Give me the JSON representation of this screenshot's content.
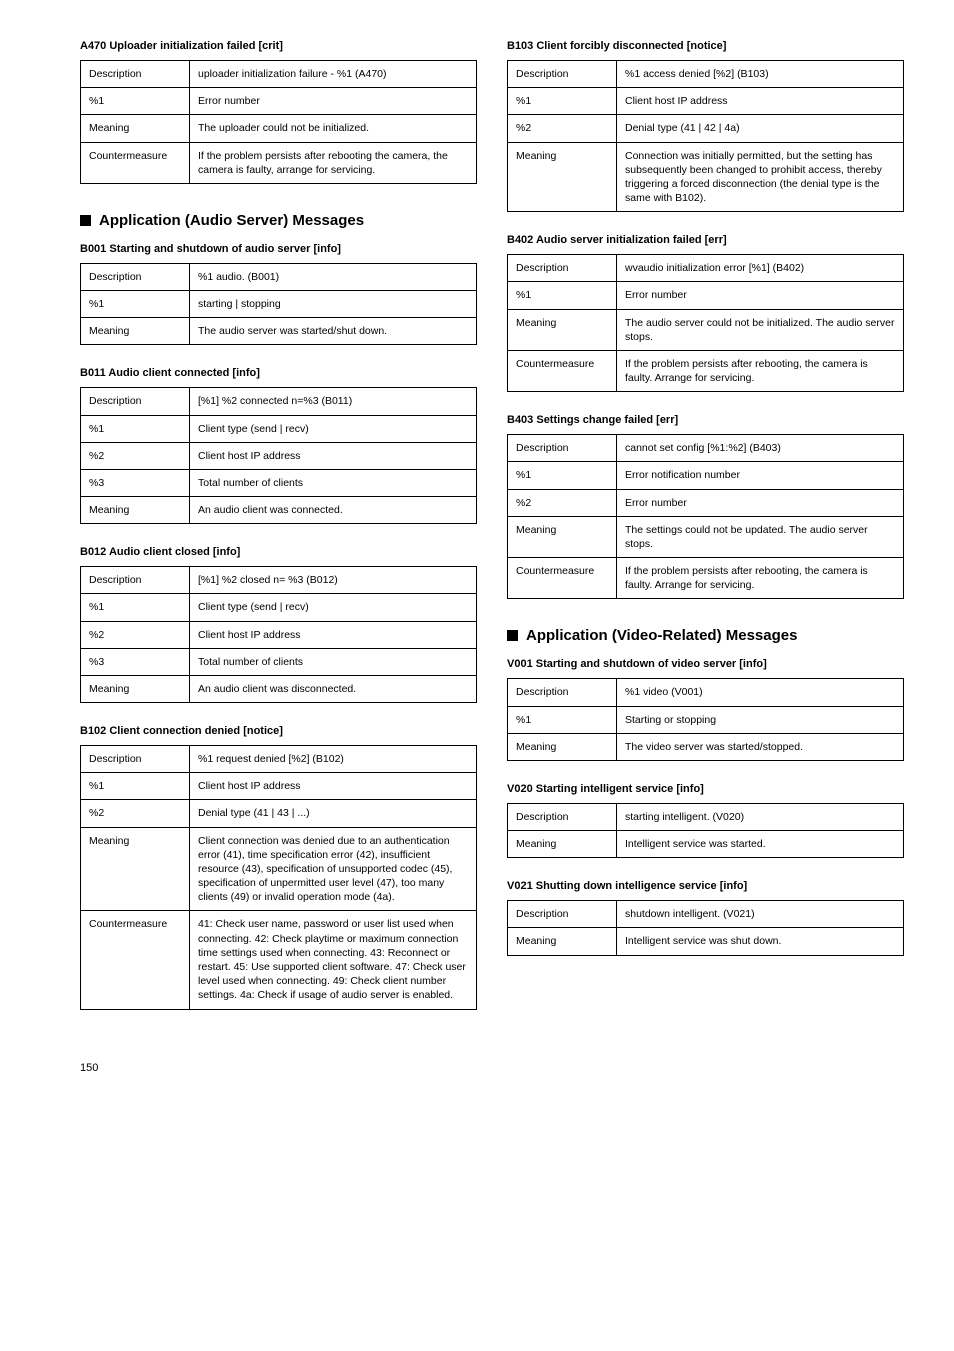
{
  "left": {
    "a470": {
      "title": "A470 Uploader initialization failed [crit]",
      "rows": [
        [
          "Description",
          "uploader initialization failure - %1 (A470)"
        ],
        [
          "%1",
          "Error number"
        ],
        [
          "Meaning",
          "The uploader could not be initialized."
        ],
        [
          "Countermeasure",
          "If the problem persists after rebooting the camera, the camera is faulty, arrange for servicing."
        ]
      ]
    },
    "audioHeading": "Application (Audio Server) Messages",
    "b001": {
      "title": "B001 Starting and shutdown of audio server [info]",
      "rows": [
        [
          "Description",
          "%1 audio. (B001)"
        ],
        [
          "%1",
          "starting | stopping"
        ],
        [
          "Meaning",
          "The audio server was started/shut down."
        ]
      ]
    },
    "b011": {
      "title": "B011 Audio client connected [info]",
      "rows": [
        [
          "Description",
          "[%1] %2 connected n=%3 (B011)"
        ],
        [
          "%1",
          "Client type (send | recv)"
        ],
        [
          "%2",
          "Client host IP address"
        ],
        [
          "%3",
          "Total number of clients"
        ],
        [
          "Meaning",
          "An audio client was connected."
        ]
      ]
    },
    "b012": {
      "title": "B012 Audio client closed [info]",
      "rows": [
        [
          "Description",
          "[%1] %2 closed n= %3 (B012)"
        ],
        [
          "%1",
          "Client type (send | recv)"
        ],
        [
          "%2",
          "Client host IP address"
        ],
        [
          "%3",
          "Total number of clients"
        ],
        [
          "Meaning",
          "An audio client was disconnected."
        ]
      ]
    },
    "b102": {
      "title": "B102 Client connection denied [notice]",
      "rows": [
        [
          "Description",
          "%1 request denied [%2] (B102)"
        ],
        [
          "%1",
          "Client host IP address"
        ],
        [
          "%2",
          "Denial type (41 | 43 | ...)"
        ],
        [
          "Meaning",
          "Client connection was denied due to an authentication error (41), time specification error (42), insufficient resource (43), specification of unsupported codec (45), specification of unpermitted user level (47), too many clients (49) or invalid operation mode (4a)."
        ],
        [
          "Countermeasure",
          "41: Check user name, password or user list used when connecting. 42: Check playtime or maximum connection time settings used when connecting. 43: Reconnect or restart. 45: Use supported client software. 47: Check user level used when connecting. 49: Check client number settings. 4a: Check if usage of audio server is enabled."
        ]
      ]
    }
  },
  "right": {
    "b103": {
      "title": "B103 Client forcibly disconnected [notice]",
      "rows": [
        [
          "Description",
          "%1 access denied [%2] (B103)"
        ],
        [
          "%1",
          "Client host IP address"
        ],
        [
          "%2",
          "Denial type (41 | 42 | 4a)"
        ],
        [
          "Meaning",
          "Connection was initially permitted, but the setting has subsequently been changed to prohibit access, thereby triggering a forced disconnection (the denial type is the same with B102)."
        ]
      ]
    },
    "b402": {
      "title": "B402 Audio server initialization failed [err]",
      "rows": [
        [
          "Description",
          "wvaudio initialization error [%1] (B402)"
        ],
        [
          "%1",
          "Error number"
        ],
        [
          "Meaning",
          "The audio server could not be initialized. The audio server stops."
        ],
        [
          "Countermeasure",
          "If the problem persists after rebooting, the camera is faulty. Arrange for servicing."
        ]
      ]
    },
    "b403": {
      "title": "B403 Settings change failed [err]",
      "rows": [
        [
          "Description",
          "cannot set config [%1:%2] (B403)"
        ],
        [
          "%1",
          "Error notification number"
        ],
        [
          "%2",
          "Error number"
        ],
        [
          "Meaning",
          "The settings could not be updated. The audio server stops."
        ],
        [
          "Countermeasure",
          "If the problem persists after rebooting, the camera is faulty. Arrange for servicing."
        ]
      ]
    },
    "videoHeading": "Application (Video-Related) Messages",
    "v001": {
      "title": "V001 Starting and shutdown of video server [info]",
      "rows": [
        [
          "Description",
          "%1 video (V001)"
        ],
        [
          "%1",
          "Starting or stopping"
        ],
        [
          "Meaning",
          "The video server was started/stopped."
        ]
      ]
    },
    "v020": {
      "title": "V020 Starting intelligent service [info]",
      "rows": [
        [
          "Description",
          "starting intelligent. (V020)"
        ],
        [
          "Meaning",
          "Intelligent service was started."
        ]
      ]
    },
    "v021": {
      "title": "V021 Shutting down intelligence service [info]",
      "rows": [
        [
          "Description",
          "shutdown intelligent. (V021)"
        ],
        [
          "Meaning",
          "Intelligent service was shut down."
        ]
      ]
    }
  },
  "pageNumber": "150"
}
